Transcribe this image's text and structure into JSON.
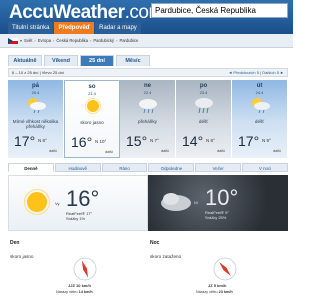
{
  "header": {
    "logo": "AccuWeather",
    "logo_tld": ".com",
    "search_value": "Pardubice, Česká Republika",
    "nav": [
      "Titulní stránka",
      "Předpověď",
      "Radar a mapy"
    ]
  },
  "breadcrumb": [
    "Svět",
    "Evropa",
    "Česká Republika",
    "Pardubický",
    "Pardubice"
  ],
  "period_tabs": [
    "Aktuálně",
    "Víkend",
    "25 dní",
    "Měsíc"
  ],
  "date_bar": {
    "left": "6 – 10 z 25 dní | Vlevo 25 dní",
    "right": "◄ Předchozích 5 | Dalších 5 ►"
  },
  "cards": [
    {
      "day": "pá",
      "date": "20.4",
      "desc": "Mírné vlhkost několika přeháňky",
      "hi": "17°",
      "lo": "N 8°",
      "more": "další"
    },
    {
      "day": "so",
      "date": "21.4",
      "desc": "skoro jasno",
      "hi": "16°",
      "lo": "N 10°",
      "more": "další"
    },
    {
      "day": "ne",
      "date": "22.4",
      "desc": "přeháňky",
      "hi": "15°",
      "lo": "N 7°",
      "more": "další"
    },
    {
      "day": "po",
      "date": "23.4",
      "desc": "déšť",
      "hi": "14°",
      "lo": "N 8°",
      "more": "další"
    },
    {
      "day": "út",
      "date": "24.4",
      "desc": "déšť",
      "hi": "17°",
      "lo": "N 9°",
      "more": "další"
    }
  ],
  "sub_tabs": [
    "Denně",
    "Hodinově",
    "Ráno",
    "Odpoledne",
    "Večer",
    "V noci"
  ],
  "day_panel": {
    "tag": "Vy",
    "temp": "16°",
    "feel": "RealFeel® 17°",
    "precip": "Srážky 1%"
  },
  "night_panel": {
    "tag": "Ni",
    "temp": "10°",
    "feel": "RealFeel® 9°",
    "precip": "Srážky 25%"
  },
  "day_details": {
    "title": "Den",
    "condition": "skoro jasno",
    "wind": "JJZ 10 km/h",
    "gust_label": "Nárazy větru",
    "gust": "14 km/h"
  },
  "night_details": {
    "title": "Noc",
    "condition": "skoro zataženo",
    "wind": "JZ 5 km/h",
    "gust_label": "Nárazy větru",
    "gust": "23 km/h"
  }
}
